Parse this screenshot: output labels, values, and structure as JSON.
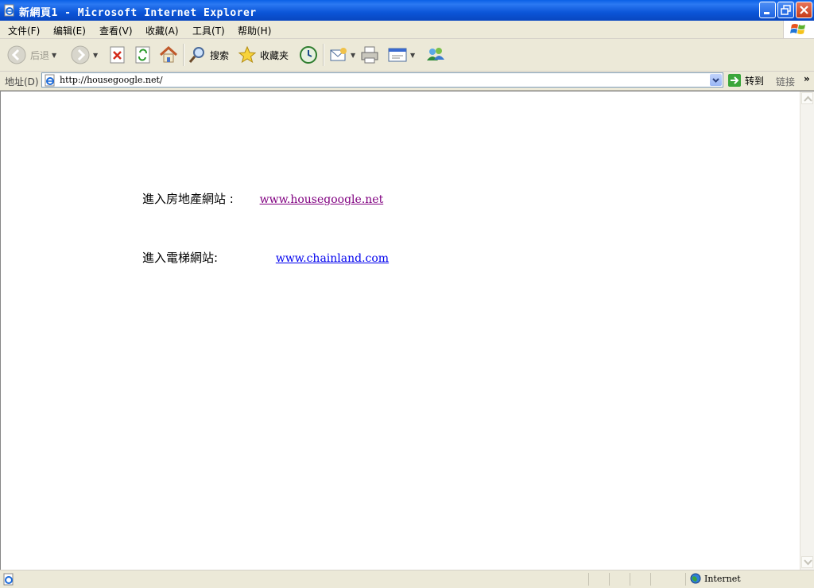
{
  "window": {
    "title": "新網頁1 - Microsoft Internet Explorer"
  },
  "menu": [
    "文件(F)",
    "编辑(E)",
    "查看(V)",
    "收藏(A)",
    "工具(T)",
    "帮助(H)"
  ],
  "toolbar": {
    "back_label": "后退",
    "search_label": "搜索",
    "favorites_label": "收藏夹"
  },
  "address": {
    "label": "地址(D)",
    "url": "http://housegoogle.net/",
    "go_label": "转到",
    "links_label": "链接"
  },
  "content": {
    "row1_label": "進入房地產網站 :",
    "row1_link": "www.housegoogle.net",
    "row2_label": "進入電梯網站:",
    "row2_link": "www.chainland.com"
  },
  "status": {
    "zone_label": "Internet"
  },
  "colors": {
    "link_visited": "#800080",
    "link_unvisited": "#0000ee",
    "titlebar": "#0b55d8"
  }
}
